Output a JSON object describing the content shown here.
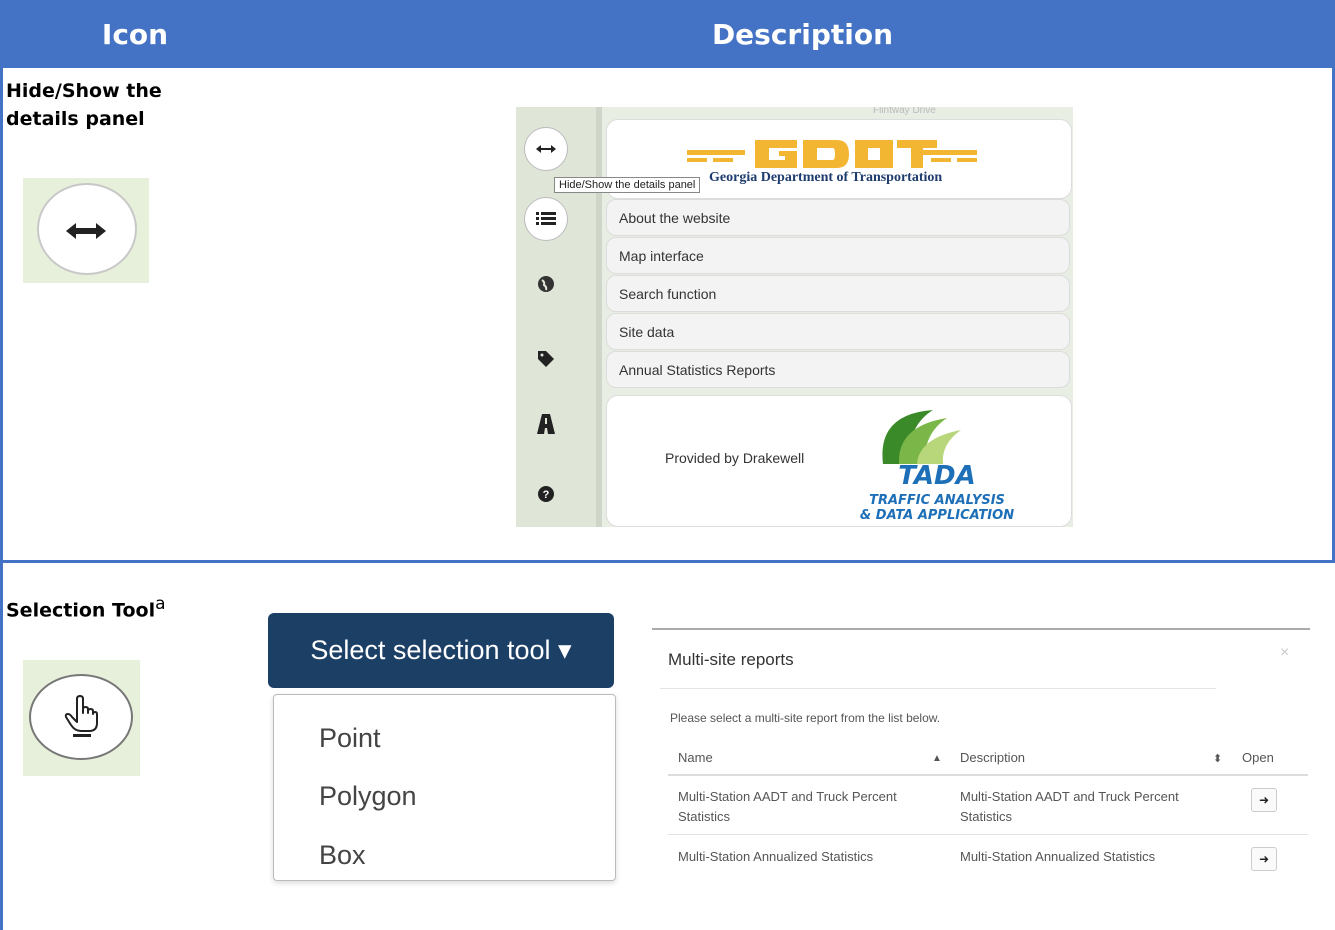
{
  "table": {
    "headers": [
      "Icon",
      "Description"
    ],
    "rows": [
      {
        "title_line1": "Hide/Show the",
        "title_line2": "details panel"
      },
      {
        "title": "Selection Tool",
        "footnote": "a"
      }
    ]
  },
  "shot1": {
    "street_label": "Flintway Drive",
    "logo_subtitle": "Georgia Department of Transportation",
    "tooltip": "Hide/Show the details panel",
    "menu_items": [
      "About the website",
      "Map interface",
      "Search function",
      "Site data",
      "Annual Statistics Reports"
    ],
    "provided_by": "Provided by Drakewell",
    "tada_logo_text": "TADA",
    "tada_line1": "TRAFFIC ANALYSIS",
    "tada_line2": "& DATA APPLICATION",
    "sidebar_icons": [
      "resize-horizontal-icon",
      "list-icon",
      "globe-icon",
      "tag-icon",
      "road-icon",
      "help-icon"
    ]
  },
  "dropdown": {
    "button_label": "Select selection tool ▾",
    "options": [
      "Point",
      "Polygon",
      "Box"
    ]
  },
  "reports": {
    "title": "Multi-site reports",
    "intro": "Please select a multi-site report from the list below.",
    "columns": {
      "name": "Name",
      "description": "Description",
      "open": "Open"
    },
    "rows": [
      {
        "name_l1": "Multi-Station AADT and Truck Percent",
        "name_l2": "Statistics",
        "desc_l1": "Multi-Station AADT and Truck Percent",
        "desc_l2": "Statistics"
      },
      {
        "name_l1": "Multi-Station Annualized Statistics",
        "desc_l1": "Multi-Station Annualized Statistics"
      }
    ]
  },
  "colors": {
    "header": "#4472c4",
    "dropdown": "#1c3f66",
    "thumb_bg": "#e7f0da"
  }
}
